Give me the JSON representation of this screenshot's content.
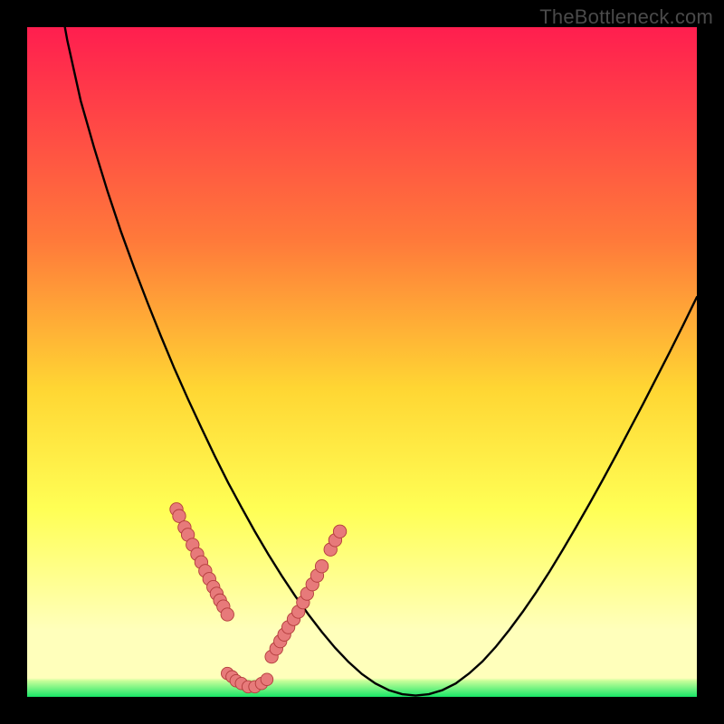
{
  "watermark": "TheBottleneck.com",
  "colors": {
    "top": "#ff1e4f",
    "mid_upper": "#ff7a3a",
    "mid": "#ffd633",
    "mid_lower": "#ffff55",
    "pale_yellow": "#ffffbb",
    "green": "#18e667",
    "curve": "#000000",
    "marker_fill": "#e77a7a",
    "marker_stroke": "#b33c3c",
    "frame": "#000000"
  },
  "chart_data": {
    "type": "line",
    "title": "",
    "xlabel": "",
    "ylabel": "",
    "xlim": [
      0,
      100
    ],
    "ylim": [
      0,
      100
    ],
    "x": [
      0,
      2,
      4,
      6,
      8,
      10,
      12,
      14,
      16,
      18,
      20,
      22,
      24,
      26,
      28,
      30,
      32,
      34,
      36,
      38,
      40,
      42,
      44,
      46,
      48,
      50,
      52,
      54,
      56,
      58,
      60,
      62,
      64,
      66,
      68,
      70,
      72,
      74,
      76,
      78,
      80,
      82,
      84,
      86,
      88,
      90,
      92,
      94,
      96,
      98,
      100
    ],
    "series": [
      {
        "name": "bottleneck-curve",
        "values": [
          138,
          122,
          109,
          98,
          89,
          82,
          75.5,
          69.5,
          64,
          58.8,
          53.8,
          49,
          44.5,
          40.2,
          36,
          32,
          28.3,
          24.7,
          21.3,
          18.1,
          15.1,
          12.3,
          9.7,
          7.3,
          5.2,
          3.4,
          2,
          1,
          0.4,
          0.2,
          0.4,
          1,
          2,
          3.5,
          5.3,
          7.5,
          10,
          12.7,
          15.6,
          18.7,
          22,
          25.4,
          28.9,
          32.5,
          36.2,
          40,
          43.8,
          47.7,
          51.6,
          55.6,
          59.7
        ]
      }
    ],
    "markers_left": [
      {
        "x": 22.3,
        "y": 28.0
      },
      {
        "x": 22.7,
        "y": 27.0
      },
      {
        "x": 23.5,
        "y": 25.3
      },
      {
        "x": 24.0,
        "y": 24.2
      },
      {
        "x": 24.7,
        "y": 22.7
      },
      {
        "x": 25.4,
        "y": 21.3
      },
      {
        "x": 26.0,
        "y": 20.1
      },
      {
        "x": 26.6,
        "y": 18.8
      },
      {
        "x": 27.2,
        "y": 17.6
      },
      {
        "x": 27.8,
        "y": 16.4
      },
      {
        "x": 28.3,
        "y": 15.4
      },
      {
        "x": 28.8,
        "y": 14.4
      },
      {
        "x": 29.3,
        "y": 13.5
      },
      {
        "x": 29.9,
        "y": 12.3
      }
    ],
    "markers_right": [
      {
        "x": 36.5,
        "y": 6.0
      },
      {
        "x": 37.2,
        "y": 7.2
      },
      {
        "x": 37.8,
        "y": 8.3
      },
      {
        "x": 38.4,
        "y": 9.3
      },
      {
        "x": 39.0,
        "y": 10.4
      },
      {
        "x": 39.8,
        "y": 11.6
      },
      {
        "x": 40.5,
        "y": 12.7
      },
      {
        "x": 41.2,
        "y": 14.1
      },
      {
        "x": 41.8,
        "y": 15.4
      },
      {
        "x": 42.6,
        "y": 16.8
      },
      {
        "x": 43.3,
        "y": 18.1
      },
      {
        "x": 44.0,
        "y": 19.5
      },
      {
        "x": 45.3,
        "y": 22.0
      },
      {
        "x": 46.0,
        "y": 23.4
      },
      {
        "x": 46.7,
        "y": 24.7
      }
    ],
    "markers_bottom": [
      {
        "x": 29.9,
        "y": 3.5
      },
      {
        "x": 30.6,
        "y": 3.0
      },
      {
        "x": 31.2,
        "y": 2.4
      },
      {
        "x": 32.0,
        "y": 2.0
      },
      {
        "x": 33.0,
        "y": 1.5
      },
      {
        "x": 34.0,
        "y": 1.5
      },
      {
        "x": 35.0,
        "y": 2.0
      },
      {
        "x": 35.8,
        "y": 2.6
      }
    ]
  }
}
